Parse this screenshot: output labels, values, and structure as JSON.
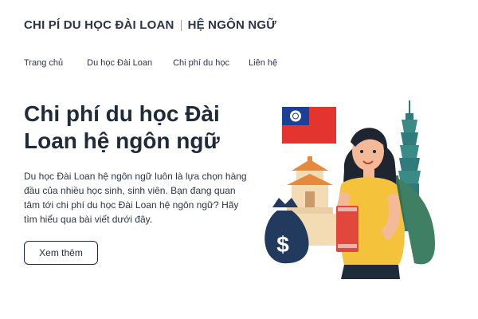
{
  "header": {
    "brand_left": "CHI PÍ DU HỌC ĐÀI LOAN",
    "brand_right": "HỆ NGÔN NGỮ"
  },
  "nav": {
    "items": [
      "Trang chủ",
      "Du học Đài Loan",
      "Chi phí du học",
      "Liên hệ"
    ]
  },
  "hero": {
    "title": "Chi phí du học Đài Loan hệ ngôn ngữ",
    "description": "Du học Đài Loan hệ ngôn ngữ luôn là lựa chọn hàng đầu của nhiều học sinh, sinh viên. Bạn đang quan tâm tới chi phí du học Đài Loan hệ ngôn ngữ? Hãy tìm hiểu qua bài viết dưới đây.",
    "cta_label": "Xem thêm"
  },
  "illustration": {
    "money_symbol": "$",
    "colors": {
      "flag_red": "#e3342f",
      "flag_blue": "#1d3f95",
      "shirt_yellow": "#f5c23c",
      "backpack_green": "#3f7f64",
      "book_red": "#e2473d",
      "money_bag": "#223a5e",
      "hair": "#1f2530",
      "skin": "#f4b997",
      "tower": "#2f7a7a",
      "temple_orange": "#e7893d"
    },
    "icons": [
      "taiwan-flag-icon",
      "temple-icon",
      "money-bag-icon",
      "taipei-101-icon",
      "student-icon",
      "book-icon",
      "backpack-icon"
    ]
  }
}
